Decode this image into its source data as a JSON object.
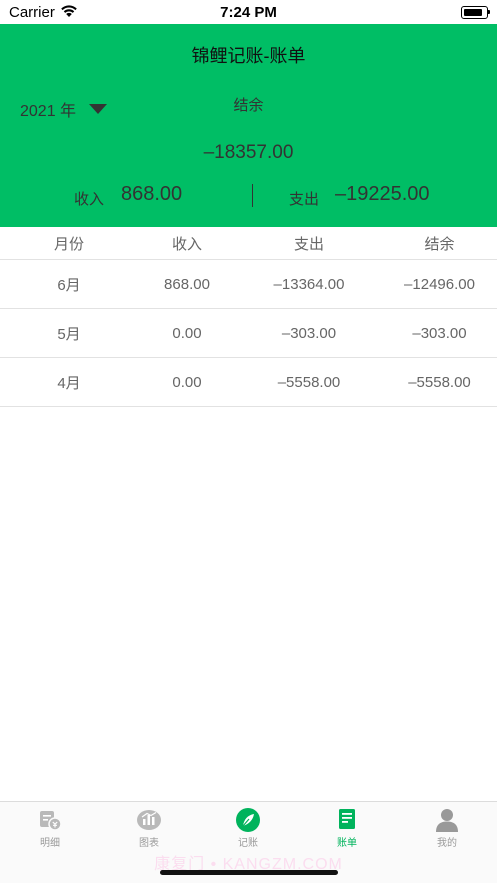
{
  "status_bar": {
    "carrier": "Carrier",
    "time": "7:24 PM"
  },
  "header": {
    "title": "锦鲤记账-账单",
    "year_label": "2021 年",
    "balance_label": "结余",
    "balance_value": "–18357.00",
    "income_label": "收入",
    "income_value": "868.00",
    "expense_label": "支出",
    "expense_value": "–19225.00",
    "background_color": "#00be65"
  },
  "table": {
    "columns": [
      "月份",
      "收入",
      "支出",
      "结余"
    ],
    "rows": [
      [
        "6月",
        "868.00",
        "–13364.00",
        "–12496.00"
      ],
      [
        "5月",
        "0.00",
        "–303.00",
        "–303.00"
      ],
      [
        "4月",
        "0.00",
        "–5558.00",
        "–5558.00"
      ]
    ]
  },
  "tab_bar": {
    "items": [
      {
        "label": "明细",
        "icon": "detail-list-icon",
        "active": false
      },
      {
        "label": "图表",
        "icon": "chart-icon",
        "active": false
      },
      {
        "label": "记账",
        "icon": "leaf-icon",
        "active": false
      },
      {
        "label": "账单",
        "icon": "bill-icon",
        "active": true
      },
      {
        "label": "我的",
        "icon": "profile-icon",
        "active": false
      }
    ],
    "active_color": "#00b35c",
    "inactive_color": "#9a9a9a"
  },
  "watermark": "康复门 • KANGZM.COM"
}
